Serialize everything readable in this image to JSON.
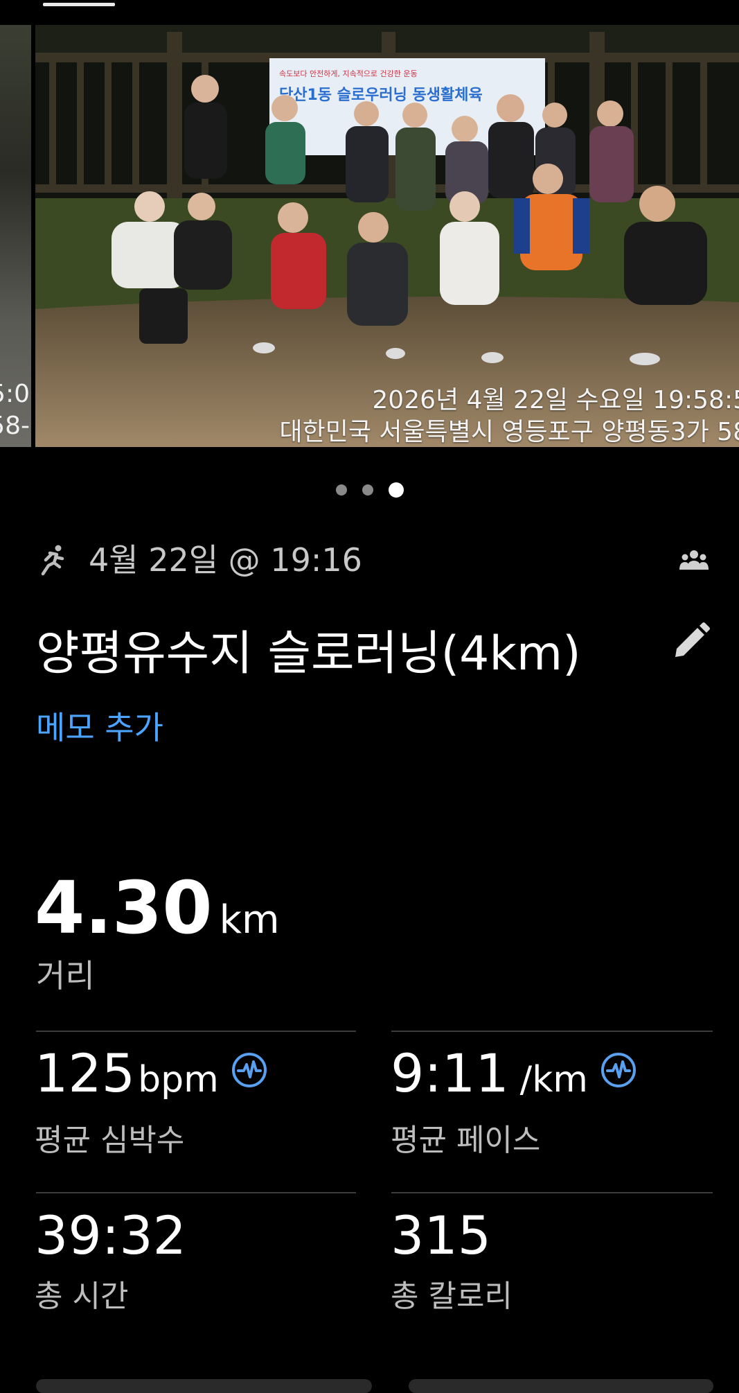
{
  "gallery": {
    "prev_photo_stamp_line1": "5:0",
    "prev_photo_stamp_line2": "58-",
    "photo_stamp_date": "2026년 4월 22일 수요일 19:58:5",
    "photo_stamp_address": "대한민국 서울특별시 영등포구 양평동3가 58",
    "banner_small_text": "속도보다 안전하게, 지속적으로 건강한 운동",
    "banner_title": "당산1동 슬로우러닝 동생활체육",
    "page_count": 3,
    "active_page": 3
  },
  "activity": {
    "icon": "running-icon",
    "date_time": "4월 22일 @ 19:16",
    "group_icon": "group-icon",
    "title": "양평유수지 슬로러닝(4km)",
    "edit_icon": "pencil-icon",
    "memo_link": "메모 추가"
  },
  "distance": {
    "value": "4.30",
    "unit": "km",
    "label": "거리"
  },
  "stats": [
    {
      "value": "125",
      "unit": "bpm",
      "label": "평균 심박수",
      "icon": "heart-rate-icon"
    },
    {
      "value": "9:11",
      "unit": "/km",
      "label": "평균 페이스",
      "icon": "heart-rate-icon"
    },
    {
      "value": "39:32",
      "unit": "",
      "label": "총 시간"
    },
    {
      "value": "315",
      "unit": "",
      "label": "총 칼로리"
    }
  ],
  "colors": {
    "background": "#000000",
    "accent_link": "#4ca4ff",
    "icon_blue": "#5aa0f0",
    "label_gray": "#bdbdbd",
    "divider": "#3c3c3c"
  }
}
